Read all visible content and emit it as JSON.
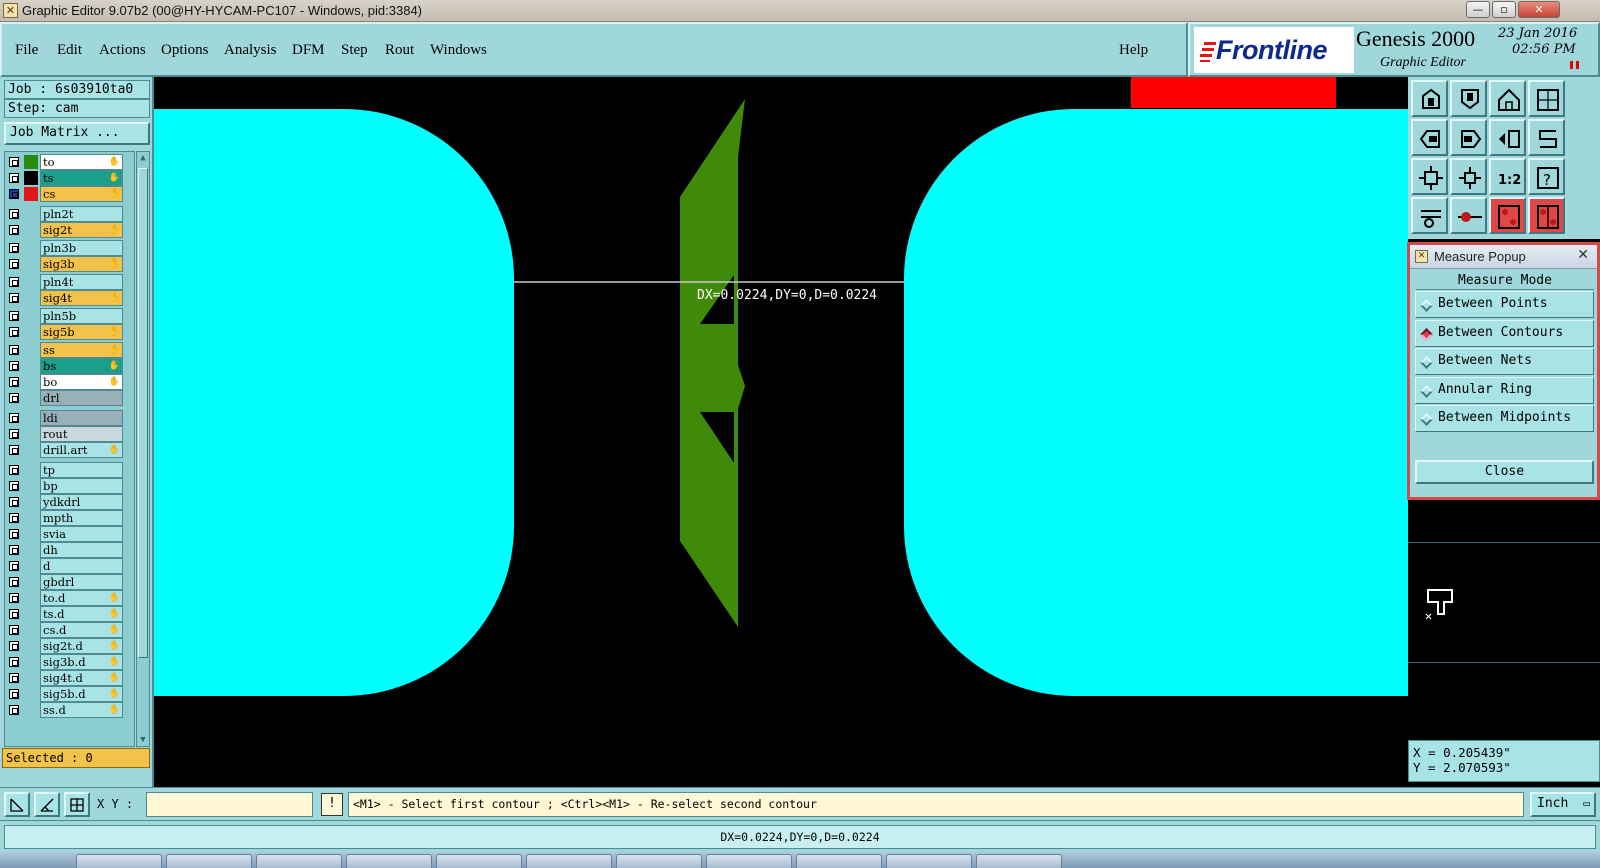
{
  "window": {
    "title": "Graphic Editor 9.07b2 (00@HY-HYCAM-PC107 - Windows, pid:3384)",
    "app_icon": "x-window-icon",
    "controls": {
      "minimize": "—",
      "maximize": "▫",
      "close": "✕"
    }
  },
  "menu": {
    "items": [
      "File",
      "Edit",
      "Actions",
      "Options",
      "Analysis",
      "DFM",
      "Step",
      "Rout",
      "Windows"
    ],
    "help": "Help"
  },
  "brand": {
    "logo": "Frontline",
    "product": "Genesis 2000",
    "subtitle": "Graphic Editor",
    "date": "23 Jan 2016",
    "time": "02:56 PM"
  },
  "job": {
    "job_line": "Job : 6s03910ta0",
    "step_line": "Step: cam",
    "matrix_button": "Job Matrix ...",
    "selected": "Selected : 0"
  },
  "layers": [
    {
      "name": "to",
      "color": "#ffffff",
      "swatch": "#2a8a10",
      "hand": true
    },
    {
      "name": "ts",
      "color": "#1aa08a",
      "swatch": "#000000",
      "hand": true
    },
    {
      "name": "cs",
      "color": "#f3c24a",
      "swatch": "#e01818",
      "hand": true,
      "active": true
    },
    {
      "name": "pln2t",
      "color": "#a8e3e6",
      "swatch": "",
      "hand": false
    },
    {
      "name": "sig2t",
      "color": "#f3c24a",
      "swatch": "",
      "hand": true
    },
    {
      "name": "pln3b",
      "color": "#a8e3e6",
      "swatch": "",
      "hand": false
    },
    {
      "name": "sig3b",
      "color": "#f3c24a",
      "swatch": "",
      "hand": true
    },
    {
      "name": "pln4t",
      "color": "#a8e3e6",
      "swatch": "",
      "hand": false
    },
    {
      "name": "sig4t",
      "color": "#f3c24a",
      "swatch": "",
      "hand": true
    },
    {
      "name": "pln5b",
      "color": "#a8e3e6",
      "swatch": "",
      "hand": false
    },
    {
      "name": "sig5b",
      "color": "#f3c24a",
      "swatch": "",
      "hand": true
    },
    {
      "name": "ss",
      "color": "#f3c24a",
      "swatch": "",
      "hand": true
    },
    {
      "name": "bs",
      "color": "#1aa08a",
      "swatch": "",
      "hand": true
    },
    {
      "name": "bo",
      "color": "#ffffff",
      "swatch": "",
      "hand": true
    },
    {
      "name": "drl",
      "color": "#9ab0b8",
      "swatch": "",
      "hand": false
    },
    {
      "name": "ldi",
      "color": "#9ab0b8",
      "swatch": "",
      "hand": false
    },
    {
      "name": "rout",
      "color": "#c8d8dc",
      "swatch": "",
      "hand": false
    },
    {
      "name": "drill.art",
      "color": "#a8e3e6",
      "swatch": "",
      "hand": true
    },
    {
      "name": "tp",
      "color": "#a8e3e6",
      "swatch": "",
      "hand": false
    },
    {
      "name": "bp",
      "color": "#a8e3e6",
      "swatch": "",
      "hand": false
    },
    {
      "name": "ydkdrl",
      "color": "#a8e3e6",
      "swatch": "",
      "hand": false
    },
    {
      "name": "mpth",
      "color": "#a8e3e6",
      "swatch": "",
      "hand": false
    },
    {
      "name": "svia",
      "color": "#a8e3e6",
      "swatch": "",
      "hand": false
    },
    {
      "name": "dh",
      "color": "#a8e3e6",
      "swatch": "",
      "hand": false
    },
    {
      "name": "d",
      "color": "#a8e3e6",
      "swatch": "",
      "hand": false
    },
    {
      "name": "gbdrl",
      "color": "#a8e3e6",
      "swatch": "",
      "hand": false
    },
    {
      "name": "to.d",
      "color": "#a8e3e6",
      "swatch": "",
      "hand": true
    },
    {
      "name": "ts.d",
      "color": "#a8e3e6",
      "swatch": "",
      "hand": true
    },
    {
      "name": "cs.d",
      "color": "#a8e3e6",
      "swatch": "",
      "hand": true
    },
    {
      "name": "sig2t.d",
      "color": "#a8e3e6",
      "swatch": "",
      "hand": true
    },
    {
      "name": "sig3b.d",
      "color": "#a8e3e6",
      "swatch": "",
      "hand": true
    },
    {
      "name": "sig4t.d",
      "color": "#a8e3e6",
      "swatch": "",
      "hand": true
    },
    {
      "name": "sig5b.d",
      "color": "#a8e3e6",
      "swatch": "",
      "hand": true
    },
    {
      "name": "ss.d",
      "color": "#a8e3e6",
      "swatch": "",
      "hand": true
    }
  ],
  "canvas": {
    "measure_label": "DX=0.0224,DY=0,D=0.0224",
    "pad_color": "#00ffff",
    "feature_color": "#3f8a08",
    "highlight_color": "#ff0000"
  },
  "toolbar_icons": [
    "pan-up-icon",
    "pan-down-icon",
    "home-icon",
    "view-frame-icon",
    "pan-left-icon",
    "pan-right-icon",
    "rotate-icon",
    "mirror-icon",
    "zoom-fit-icon",
    "zoom-out-icon",
    "scale-1to2-icon",
    "help-question-icon",
    "snap-tool-icon",
    "measure-icon",
    "layer-compare-icon",
    "layer-split-icon"
  ],
  "measure_popup": {
    "title": "Measure Popup",
    "close_x": "✕",
    "header": "Measure Mode",
    "options": [
      {
        "label": "Between Points",
        "selected": false
      },
      {
        "label": "Between Contours",
        "selected": true
      },
      {
        "label": "Between Nets",
        "selected": false
      },
      {
        "label": "Annular Ring",
        "selected": false
      },
      {
        "label": "Between Midpoints",
        "selected": false
      }
    ],
    "close_button": "Close"
  },
  "coords": {
    "x_line": "X = 0.205439\"",
    "y_line": "Y = 2.070593\""
  },
  "command": {
    "xy_label": "X Y :",
    "xy_value": "",
    "prompt_icon": "!",
    "prompt": "<M1> - Select first contour ; <Ctrl><M1> - Re-select second contour",
    "unit": "Inch",
    "unit_dropdown": "▭"
  },
  "status": {
    "text": "DX=0.0224,DY=0,D=0.0224"
  }
}
